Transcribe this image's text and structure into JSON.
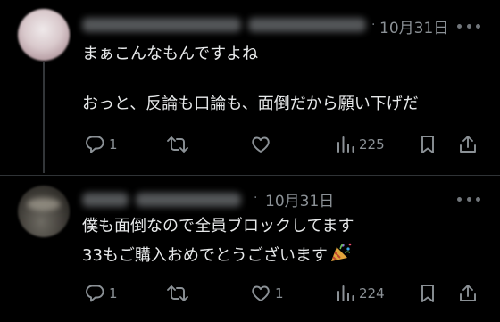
{
  "tweets": [
    {
      "time": "10月31日",
      "line1": "まぁこんなもんですよね",
      "line2": "おっと、反論も口論も、面倒だから願い下げだ",
      "replies": "1",
      "retweets": "",
      "likes": "",
      "views": "225"
    },
    {
      "time": "10月31日",
      "line1": "僕も面倒なので全員ブロックしてます",
      "line2": "33もご購入おめでとうございます",
      "replies": "1",
      "retweets": "",
      "likes": "1",
      "views": "224"
    }
  ],
  "icons": {
    "reply": "reply-icon",
    "retweet": "retweet-icon",
    "like": "heart-icon",
    "views": "views-icon",
    "bookmark": "bookmark-icon",
    "share": "share-icon",
    "party": "party-popper-icon"
  },
  "colors": {
    "background": "#000000",
    "text": "#e7e9ea",
    "muted": "#71767b"
  }
}
